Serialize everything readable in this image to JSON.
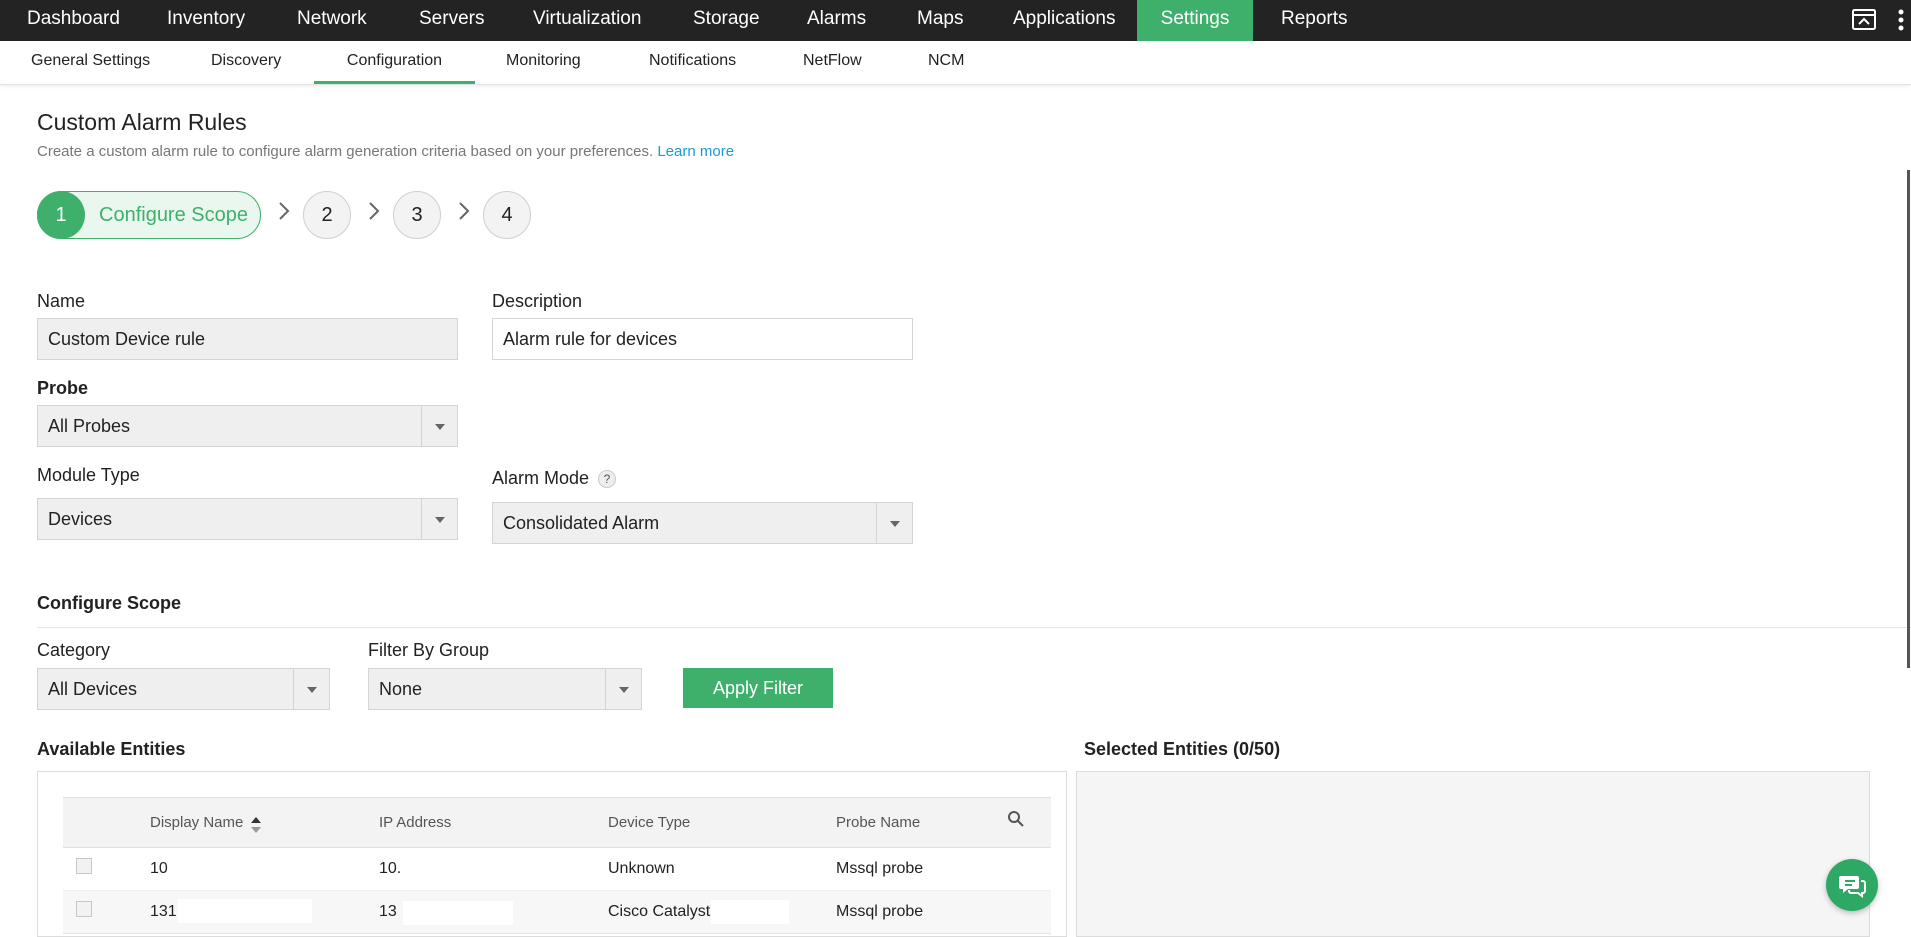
{
  "topnav": {
    "tabs": [
      {
        "label": "Dashboard"
      },
      {
        "label": "Inventory"
      },
      {
        "label": "Network"
      },
      {
        "label": "Servers"
      },
      {
        "label": "Virtualization"
      },
      {
        "label": "Storage"
      },
      {
        "label": "Alarms"
      },
      {
        "label": "Maps"
      },
      {
        "label": "Applications"
      },
      {
        "label": "Settings"
      },
      {
        "label": "Reports"
      }
    ],
    "active_tab": "Settings",
    "accent_color": "#3fb06c"
  },
  "subnav": {
    "tabs": [
      {
        "label": "General Settings"
      },
      {
        "label": "Discovery"
      },
      {
        "label": "Configuration"
      },
      {
        "label": "Monitoring"
      },
      {
        "label": "Notifications"
      },
      {
        "label": "NetFlow"
      },
      {
        "label": "NCM"
      }
    ],
    "active_tab": "Configuration"
  },
  "page": {
    "title": "Custom Alarm Rules",
    "subtitle": "Create a custom alarm rule to configure alarm generation criteria based on your preferences.",
    "learn_more": "Learn more"
  },
  "wizard": {
    "steps": [
      {
        "num": "1",
        "label": "Configure Scope"
      },
      {
        "num": "2"
      },
      {
        "num": "3"
      },
      {
        "num": "4"
      }
    ]
  },
  "form": {
    "name_label": "Name",
    "name_value": "Custom Device rule",
    "description_label": "Description",
    "description_value": "Alarm rule for devices",
    "probe_label": "Probe",
    "probe_value": "All Probes",
    "module_type_label": "Module Type",
    "module_type_value": "Devices",
    "alarm_mode_label": "Alarm Mode",
    "alarm_mode_help": "?",
    "alarm_mode_value": "Consolidated Alarm"
  },
  "scope": {
    "title": "Configure Scope",
    "category_label": "Category",
    "category_value": "All Devices",
    "filter_group_label": "Filter By Group",
    "filter_group_value": "None",
    "apply_button": "Apply Filter"
  },
  "available": {
    "title": "Available Entities",
    "columns": [
      "Display Name",
      "IP Address",
      "Device Type",
      "Probe Name"
    ],
    "rows": [
      {
        "display": "10",
        "ip": "10.",
        "type": "Unknown",
        "probe": "Mssql probe"
      },
      {
        "display": "131",
        "ip": "13",
        "type": "Cisco Catalyst",
        "probe": "Mssql probe"
      }
    ]
  },
  "selected": {
    "title": "Selected Entities (0/50)"
  },
  "icons": {
    "top_right_1": "window-icon",
    "top_right_2": "kebab-menu-icon",
    "chat": "chat-icon",
    "search": "search-icon",
    "sort": "sort-icon"
  }
}
